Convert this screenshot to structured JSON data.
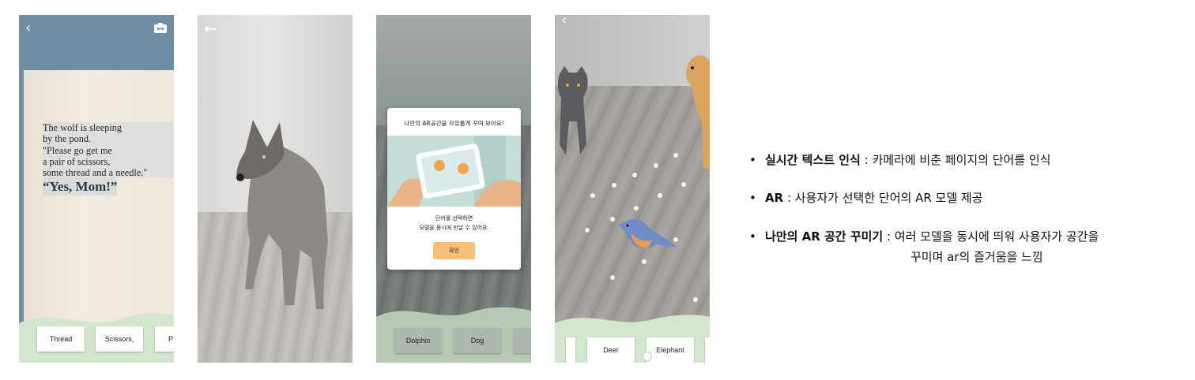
{
  "screen1": {
    "book_lines": [
      "The wolf is sleeping",
      "by the pond.",
      "\"Please go get me",
      "a pair of scissors,",
      "some thread and a needle.\""
    ],
    "book_highlight": "“Yes, Mom!”",
    "chips": [
      "Thread",
      "Scissors,",
      "P"
    ],
    "camera_icon": "camera-flip-icon"
  },
  "screen2": {
    "back_icon": "arrow-left-icon"
  },
  "screen3": {
    "modal_title": "나만의 AR공간을 자유롭게 꾸며 보아요!",
    "modal_body_line1": "단어를 선택하면",
    "modal_body_line2": "모델을 동시에 만날 수 있어요.",
    "confirm_label": "확인",
    "chips": [
      "Dolphin",
      "Dog"
    ]
  },
  "screen4": {
    "chips": [
      "Deer",
      "Elephant"
    ]
  },
  "features": [
    {
      "bullet": "•",
      "key": "실시간 텍스트 인식",
      "desc": " : 카메라에 비춘 페이지의 단어를 인식"
    },
    {
      "bullet": "•",
      "key": "AR",
      "desc": " : 사용자가 선택한 단어의 AR 모델 제공"
    },
    {
      "bullet": "•",
      "key": "나만의 AR 공간 꾸미기",
      "desc": " : 여러 모델을 동시에 띄워 사용자가 공간을",
      "desc_cont": "꾸미며 ar의 즐거움을 느낌"
    }
  ],
  "colors": {
    "wave_green": "#d3e7cf",
    "confirm_orange": "#f6bf75"
  }
}
